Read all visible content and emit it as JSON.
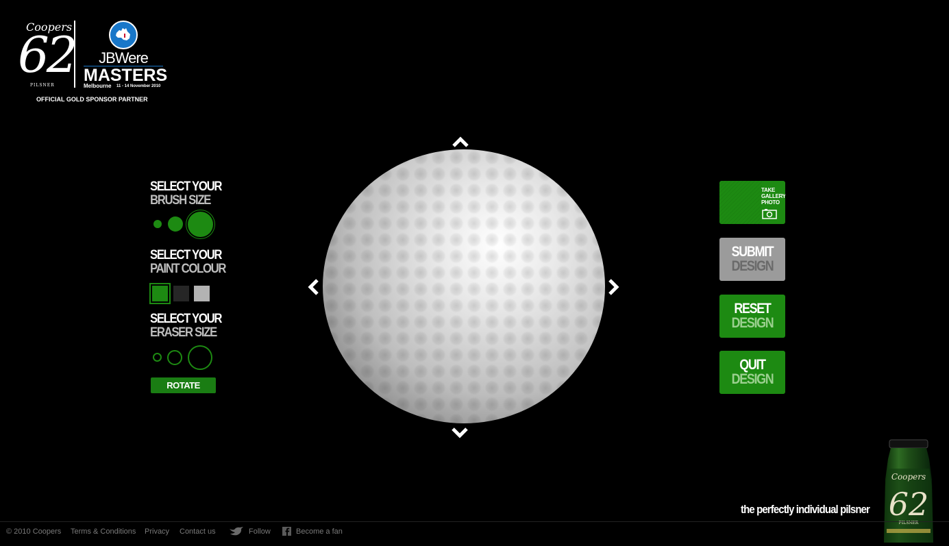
{
  "header": {
    "brand_script": "Coopers",
    "brand_number": "62",
    "brand_sub": "PILSNER",
    "event_name": "JBWere",
    "event_title": "MASTERS",
    "event_city": "Melbourne",
    "event_dates": "11 - 14 November 2010",
    "sponsor_text": "OFFICIAL GOLD SPONSOR PARTNER"
  },
  "left_panel": {
    "brush": {
      "line1": "SELECT YOUR",
      "line2": "BRUSH SIZE"
    },
    "paint": {
      "line1": "SELECT YOUR",
      "line2": "PAINT COLOUR",
      "colors": [
        "#1d8a12",
        "#262626",
        "#b3b3b3"
      ],
      "selected_index": 0
    },
    "eraser": {
      "line1": "SELECT YOUR",
      "line2": "ERASER SIZE"
    },
    "rotate_label": "ROTATE"
  },
  "right_panel": {
    "photo": {
      "line1": "TAKE",
      "line2": "GALLERY",
      "line3": "PHOTO"
    },
    "submit": {
      "line1": "SUBMIT",
      "line2": "DESIGN"
    },
    "reset": {
      "line1": "RESET",
      "line2": "DESIGN"
    },
    "quit": {
      "line1": "QUIT",
      "line2": "DESIGN"
    }
  },
  "tagline": "the perfectly individual pilsner",
  "footer": {
    "copyright": "© 2010 Coopers",
    "terms": "Terms & Conditions",
    "privacy": "Privacy",
    "contact": "Contact us",
    "follow": "Follow",
    "fan": "Become a fan"
  },
  "bottle": {
    "script": "Coopers",
    "number": "62",
    "sub": "PILSNER"
  },
  "icons": [
    "australia-badge-icon",
    "arrow-up-icon",
    "arrow-down-icon",
    "arrow-left-icon",
    "arrow-right-icon",
    "camera-icon",
    "twitter-bird-icon",
    "facebook-icon"
  ]
}
